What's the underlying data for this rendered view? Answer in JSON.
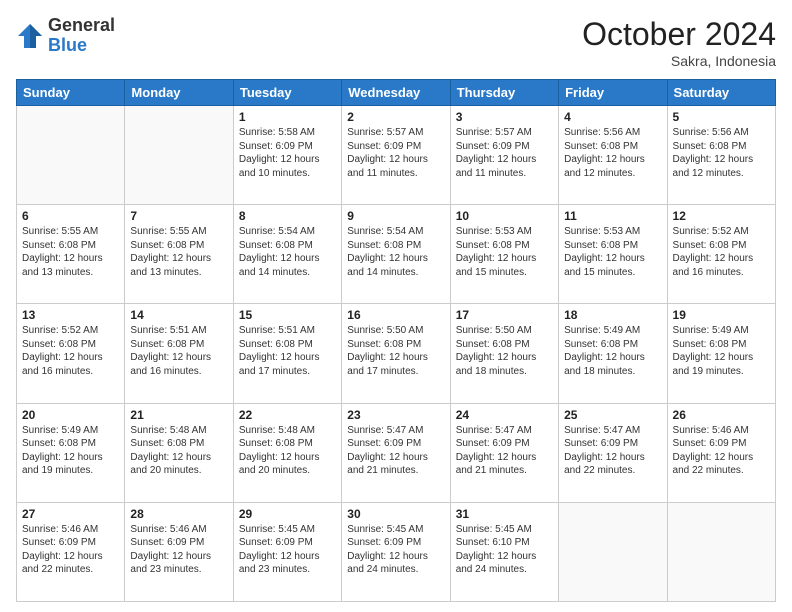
{
  "header": {
    "logo_general": "General",
    "logo_blue": "Blue",
    "month_title": "October 2024",
    "location": "Sakra, Indonesia"
  },
  "days_of_week": [
    "Sunday",
    "Monday",
    "Tuesday",
    "Wednesday",
    "Thursday",
    "Friday",
    "Saturday"
  ],
  "weeks": [
    [
      {
        "day": "",
        "info": ""
      },
      {
        "day": "",
        "info": ""
      },
      {
        "day": "1",
        "info": "Sunrise: 5:58 AM\nSunset: 6:09 PM\nDaylight: 12 hours and 10 minutes."
      },
      {
        "day": "2",
        "info": "Sunrise: 5:57 AM\nSunset: 6:09 PM\nDaylight: 12 hours and 11 minutes."
      },
      {
        "day": "3",
        "info": "Sunrise: 5:57 AM\nSunset: 6:09 PM\nDaylight: 12 hours and 11 minutes."
      },
      {
        "day": "4",
        "info": "Sunrise: 5:56 AM\nSunset: 6:08 PM\nDaylight: 12 hours and 12 minutes."
      },
      {
        "day": "5",
        "info": "Sunrise: 5:56 AM\nSunset: 6:08 PM\nDaylight: 12 hours and 12 minutes."
      }
    ],
    [
      {
        "day": "6",
        "info": "Sunrise: 5:55 AM\nSunset: 6:08 PM\nDaylight: 12 hours and 13 minutes."
      },
      {
        "day": "7",
        "info": "Sunrise: 5:55 AM\nSunset: 6:08 PM\nDaylight: 12 hours and 13 minutes."
      },
      {
        "day": "8",
        "info": "Sunrise: 5:54 AM\nSunset: 6:08 PM\nDaylight: 12 hours and 14 minutes."
      },
      {
        "day": "9",
        "info": "Sunrise: 5:54 AM\nSunset: 6:08 PM\nDaylight: 12 hours and 14 minutes."
      },
      {
        "day": "10",
        "info": "Sunrise: 5:53 AM\nSunset: 6:08 PM\nDaylight: 12 hours and 15 minutes."
      },
      {
        "day": "11",
        "info": "Sunrise: 5:53 AM\nSunset: 6:08 PM\nDaylight: 12 hours and 15 minutes."
      },
      {
        "day": "12",
        "info": "Sunrise: 5:52 AM\nSunset: 6:08 PM\nDaylight: 12 hours and 16 minutes."
      }
    ],
    [
      {
        "day": "13",
        "info": "Sunrise: 5:52 AM\nSunset: 6:08 PM\nDaylight: 12 hours and 16 minutes."
      },
      {
        "day": "14",
        "info": "Sunrise: 5:51 AM\nSunset: 6:08 PM\nDaylight: 12 hours and 16 minutes."
      },
      {
        "day": "15",
        "info": "Sunrise: 5:51 AM\nSunset: 6:08 PM\nDaylight: 12 hours and 17 minutes."
      },
      {
        "day": "16",
        "info": "Sunrise: 5:50 AM\nSunset: 6:08 PM\nDaylight: 12 hours and 17 minutes."
      },
      {
        "day": "17",
        "info": "Sunrise: 5:50 AM\nSunset: 6:08 PM\nDaylight: 12 hours and 18 minutes."
      },
      {
        "day": "18",
        "info": "Sunrise: 5:49 AM\nSunset: 6:08 PM\nDaylight: 12 hours and 18 minutes."
      },
      {
        "day": "19",
        "info": "Sunrise: 5:49 AM\nSunset: 6:08 PM\nDaylight: 12 hours and 19 minutes."
      }
    ],
    [
      {
        "day": "20",
        "info": "Sunrise: 5:49 AM\nSunset: 6:08 PM\nDaylight: 12 hours and 19 minutes."
      },
      {
        "day": "21",
        "info": "Sunrise: 5:48 AM\nSunset: 6:08 PM\nDaylight: 12 hours and 20 minutes."
      },
      {
        "day": "22",
        "info": "Sunrise: 5:48 AM\nSunset: 6:08 PM\nDaylight: 12 hours and 20 minutes."
      },
      {
        "day": "23",
        "info": "Sunrise: 5:47 AM\nSunset: 6:09 PM\nDaylight: 12 hours and 21 minutes."
      },
      {
        "day": "24",
        "info": "Sunrise: 5:47 AM\nSunset: 6:09 PM\nDaylight: 12 hours and 21 minutes."
      },
      {
        "day": "25",
        "info": "Sunrise: 5:47 AM\nSunset: 6:09 PM\nDaylight: 12 hours and 22 minutes."
      },
      {
        "day": "26",
        "info": "Sunrise: 5:46 AM\nSunset: 6:09 PM\nDaylight: 12 hours and 22 minutes."
      }
    ],
    [
      {
        "day": "27",
        "info": "Sunrise: 5:46 AM\nSunset: 6:09 PM\nDaylight: 12 hours and 22 minutes."
      },
      {
        "day": "28",
        "info": "Sunrise: 5:46 AM\nSunset: 6:09 PM\nDaylight: 12 hours and 23 minutes."
      },
      {
        "day": "29",
        "info": "Sunrise: 5:45 AM\nSunset: 6:09 PM\nDaylight: 12 hours and 23 minutes."
      },
      {
        "day": "30",
        "info": "Sunrise: 5:45 AM\nSunset: 6:09 PM\nDaylight: 12 hours and 24 minutes."
      },
      {
        "day": "31",
        "info": "Sunrise: 5:45 AM\nSunset: 6:10 PM\nDaylight: 12 hours and 24 minutes."
      },
      {
        "day": "",
        "info": ""
      },
      {
        "day": "",
        "info": ""
      }
    ]
  ]
}
